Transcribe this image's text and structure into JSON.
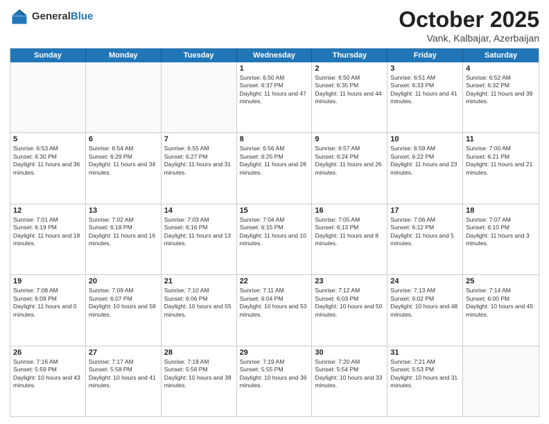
{
  "header": {
    "logo_general": "General",
    "logo_blue": "Blue",
    "title": "October 2025",
    "location": "Vank, Kalbajar, Azerbaijan"
  },
  "weekdays": [
    "Sunday",
    "Monday",
    "Tuesday",
    "Wednesday",
    "Thursday",
    "Friday",
    "Saturday"
  ],
  "weeks": [
    [
      {
        "day": "",
        "sunrise": "",
        "sunset": "",
        "daylight": ""
      },
      {
        "day": "",
        "sunrise": "",
        "sunset": "",
        "daylight": ""
      },
      {
        "day": "",
        "sunrise": "",
        "sunset": "",
        "daylight": ""
      },
      {
        "day": "1",
        "sunrise": "Sunrise: 6:50 AM",
        "sunset": "Sunset: 6:37 PM",
        "daylight": "Daylight: 11 hours and 47 minutes."
      },
      {
        "day": "2",
        "sunrise": "Sunrise: 6:50 AM",
        "sunset": "Sunset: 6:35 PM",
        "daylight": "Daylight: 11 hours and 44 minutes."
      },
      {
        "day": "3",
        "sunrise": "Sunrise: 6:51 AM",
        "sunset": "Sunset: 6:33 PM",
        "daylight": "Daylight: 11 hours and 41 minutes."
      },
      {
        "day": "4",
        "sunrise": "Sunrise: 6:52 AM",
        "sunset": "Sunset: 6:32 PM",
        "daylight": "Daylight: 11 hours and 39 minutes."
      }
    ],
    [
      {
        "day": "5",
        "sunrise": "Sunrise: 6:53 AM",
        "sunset": "Sunset: 6:30 PM",
        "daylight": "Daylight: 11 hours and 36 minutes."
      },
      {
        "day": "6",
        "sunrise": "Sunrise: 6:54 AM",
        "sunset": "Sunset: 6:29 PM",
        "daylight": "Daylight: 11 hours and 34 minutes."
      },
      {
        "day": "7",
        "sunrise": "Sunrise: 6:55 AM",
        "sunset": "Sunset: 6:27 PM",
        "daylight": "Daylight: 11 hours and 31 minutes."
      },
      {
        "day": "8",
        "sunrise": "Sunrise: 6:56 AM",
        "sunset": "Sunset: 6:25 PM",
        "daylight": "Daylight: 11 hours and 28 minutes."
      },
      {
        "day": "9",
        "sunrise": "Sunrise: 6:57 AM",
        "sunset": "Sunset: 6:24 PM",
        "daylight": "Daylight: 11 hours and 26 minutes."
      },
      {
        "day": "10",
        "sunrise": "Sunrise: 6:59 AM",
        "sunset": "Sunset: 6:22 PM",
        "daylight": "Daylight: 11 hours and 23 minutes."
      },
      {
        "day": "11",
        "sunrise": "Sunrise: 7:00 AM",
        "sunset": "Sunset: 6:21 PM",
        "daylight": "Daylight: 11 hours and 21 minutes."
      }
    ],
    [
      {
        "day": "12",
        "sunrise": "Sunrise: 7:01 AM",
        "sunset": "Sunset: 6:19 PM",
        "daylight": "Daylight: 11 hours and 18 minutes."
      },
      {
        "day": "13",
        "sunrise": "Sunrise: 7:02 AM",
        "sunset": "Sunset: 6:18 PM",
        "daylight": "Daylight: 11 hours and 16 minutes."
      },
      {
        "day": "14",
        "sunrise": "Sunrise: 7:03 AM",
        "sunset": "Sunset: 6:16 PM",
        "daylight": "Daylight: 11 hours and 13 minutes."
      },
      {
        "day": "15",
        "sunrise": "Sunrise: 7:04 AM",
        "sunset": "Sunset: 6:15 PM",
        "daylight": "Daylight: 11 hours and 10 minutes."
      },
      {
        "day": "16",
        "sunrise": "Sunrise: 7:05 AM",
        "sunset": "Sunset: 6:13 PM",
        "daylight": "Daylight: 11 hours and 8 minutes."
      },
      {
        "day": "17",
        "sunrise": "Sunrise: 7:06 AM",
        "sunset": "Sunset: 6:12 PM",
        "daylight": "Daylight: 11 hours and 5 minutes."
      },
      {
        "day": "18",
        "sunrise": "Sunrise: 7:07 AM",
        "sunset": "Sunset: 6:10 PM",
        "daylight": "Daylight: 11 hours and 3 minutes."
      }
    ],
    [
      {
        "day": "19",
        "sunrise": "Sunrise: 7:08 AM",
        "sunset": "Sunset: 6:09 PM",
        "daylight": "Daylight: 11 hours and 0 minutes."
      },
      {
        "day": "20",
        "sunrise": "Sunrise: 7:09 AM",
        "sunset": "Sunset: 6:07 PM",
        "daylight": "Daylight: 10 hours and 58 minutes."
      },
      {
        "day": "21",
        "sunrise": "Sunrise: 7:10 AM",
        "sunset": "Sunset: 6:06 PM",
        "daylight": "Daylight: 10 hours and 55 minutes."
      },
      {
        "day": "22",
        "sunrise": "Sunrise: 7:11 AM",
        "sunset": "Sunset: 6:04 PM",
        "daylight": "Daylight: 10 hours and 53 minutes."
      },
      {
        "day": "23",
        "sunrise": "Sunrise: 7:12 AM",
        "sunset": "Sunset: 6:03 PM",
        "daylight": "Daylight: 10 hours and 50 minutes."
      },
      {
        "day": "24",
        "sunrise": "Sunrise: 7:13 AM",
        "sunset": "Sunset: 6:02 PM",
        "daylight": "Daylight: 10 hours and 48 minutes."
      },
      {
        "day": "25",
        "sunrise": "Sunrise: 7:14 AM",
        "sunset": "Sunset: 6:00 PM",
        "daylight": "Daylight: 10 hours and 45 minutes."
      }
    ],
    [
      {
        "day": "26",
        "sunrise": "Sunrise: 7:16 AM",
        "sunset": "Sunset: 5:59 PM",
        "daylight": "Daylight: 10 hours and 43 minutes."
      },
      {
        "day": "27",
        "sunrise": "Sunrise: 7:17 AM",
        "sunset": "Sunset: 5:58 PM",
        "daylight": "Daylight: 10 hours and 41 minutes."
      },
      {
        "day": "28",
        "sunrise": "Sunrise: 7:18 AM",
        "sunset": "Sunset: 5:56 PM",
        "daylight": "Daylight: 10 hours and 38 minutes."
      },
      {
        "day": "29",
        "sunrise": "Sunrise: 7:19 AM",
        "sunset": "Sunset: 5:55 PM",
        "daylight": "Daylight: 10 hours and 36 minutes."
      },
      {
        "day": "30",
        "sunrise": "Sunrise: 7:20 AM",
        "sunset": "Sunset: 5:54 PM",
        "daylight": "Daylight: 10 hours and 33 minutes."
      },
      {
        "day": "31",
        "sunrise": "Sunrise: 7:21 AM",
        "sunset": "Sunset: 5:53 PM",
        "daylight": "Daylight: 10 hours and 31 minutes."
      },
      {
        "day": "",
        "sunrise": "",
        "sunset": "",
        "daylight": ""
      }
    ]
  ]
}
